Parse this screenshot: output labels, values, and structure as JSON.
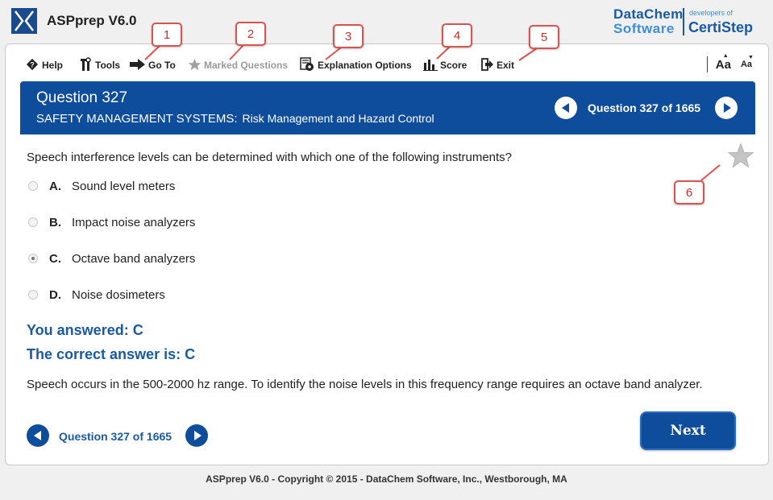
{
  "app": {
    "title": "ASPprep V6.0"
  },
  "brand": {
    "line1": "DataChem",
    "line2": "Software",
    "tag": "developers of",
    "product": "CertiStep"
  },
  "toolbar": {
    "help": "Help",
    "tools": "Tools",
    "goto": "Go To",
    "marked": "Marked Questions",
    "explanation": "Explanation Options",
    "score": "Score",
    "exit": "Exit",
    "font_large": "Aa",
    "font_small": "Aa"
  },
  "question": {
    "title": "Question 327",
    "category": "SAFETY MANAGEMENT SYSTEMS:",
    "subcategory": "Risk Management and Hazard Control",
    "counter": "Question 327 of 1665",
    "text": "Speech interference levels can be determined with which one of the following instruments?",
    "options": [
      {
        "letter": "A.",
        "text": "Sound level meters",
        "selected": false
      },
      {
        "letter": "B.",
        "text": "Impact noise analyzers",
        "selected": false
      },
      {
        "letter": "C.",
        "text": "Octave band analyzers",
        "selected": true
      },
      {
        "letter": "D.",
        "text": "Noise dosimeters",
        "selected": false
      }
    ]
  },
  "result": {
    "answered": "You answered: C",
    "correct": "The correct answer is: C",
    "explanation": "Speech occurs in the 500-2000 hz range. To identify the noise levels in this frequency range requires an octave band analyzer."
  },
  "bottom_nav": {
    "counter": "Question 327 of 1665",
    "next": "Next"
  },
  "footer": "ASPprep V6.0 - Copyright © 2015 - DataChem Software, Inc., Westborough, MA",
  "callouts": [
    "1",
    "2",
    "3",
    "4",
    "5",
    "6"
  ],
  "colors": {
    "primary": "#0e4d9c",
    "accent_text": "#1a5aa3",
    "callout_border": "#d9534f"
  }
}
